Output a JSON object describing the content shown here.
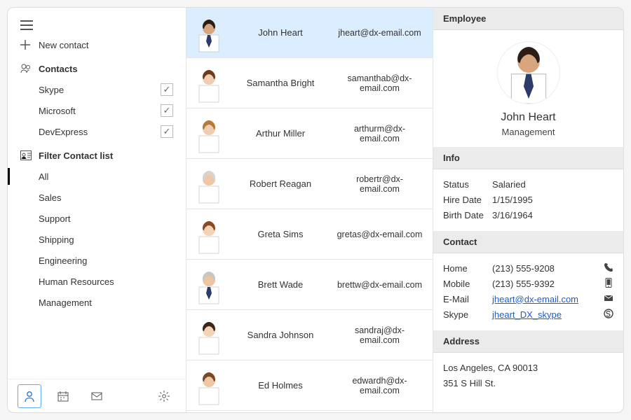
{
  "sidebar": {
    "new_contact": "New contact",
    "contacts_header": "Contacts",
    "groups": [
      {
        "label": "Skype",
        "checked": true
      },
      {
        "label": "Microsoft",
        "checked": true
      },
      {
        "label": "DevExpress",
        "checked": true
      }
    ],
    "filter_header": "Filter Contact list",
    "filters": [
      {
        "label": "All",
        "active": true
      },
      {
        "label": "Sales"
      },
      {
        "label": "Support"
      },
      {
        "label": "Shipping"
      },
      {
        "label": "Engineering"
      },
      {
        "label": "Human Resources"
      },
      {
        "label": "Management"
      }
    ]
  },
  "contacts": [
    {
      "name": "John Heart",
      "email": "jheart@dx-email.com",
      "selected": true,
      "tie": true,
      "hair": "#2b1e14",
      "skin": "#d7a67e"
    },
    {
      "name": "Samantha Bright",
      "email": "samanthab@dx-email.com",
      "selected": false,
      "tie": false,
      "hair": "#6b3b1a",
      "skin": "#f0cdb0"
    },
    {
      "name": "Arthur Miller",
      "email": "arthurm@dx-email.com",
      "selected": false,
      "tie": false,
      "hair": "#b57a36",
      "skin": "#f0cdb0"
    },
    {
      "name": "Robert Reagan",
      "email": "robertr@dx-email.com",
      "selected": false,
      "tie": false,
      "hair": "#d9d3cb",
      "skin": "#eec7a6"
    },
    {
      "name": "Greta Sims",
      "email": "gretas@dx-email.com",
      "selected": false,
      "tie": false,
      "hair": "#8a4a22",
      "skin": "#f3d3b6"
    },
    {
      "name": "Brett Wade",
      "email": "brettw@dx-email.com",
      "selected": false,
      "tie": true,
      "hair": "#c9c6c2",
      "skin": "#eec3a0"
    },
    {
      "name": "Sandra Johnson",
      "email": "sandraj@dx-email.com",
      "selected": false,
      "tie": false,
      "hair": "#3a271a",
      "skin": "#f3d3b6"
    },
    {
      "name": "Ed Holmes",
      "email": "edwardh@dx-email.com",
      "selected": false,
      "tie": false,
      "hair": "#7a4a24",
      "skin": "#eec7a6"
    }
  ],
  "detail": {
    "employee_header": "Employee",
    "name": "John Heart",
    "department": "Management",
    "info_header": "Info",
    "info": {
      "status_label": "Status",
      "status_value": "Salaried",
      "hire_label": "Hire Date",
      "hire_value": "1/15/1995",
      "birth_label": "Birth Date",
      "birth_value": "3/16/1964"
    },
    "contact_header": "Contact",
    "contact": {
      "home_label": "Home",
      "home_value": "(213) 555-9208",
      "mobile_label": "Mobile",
      "mobile_value": "(213) 555-9392",
      "email_label": "E-Mail",
      "email_value": "jheart@dx-email.com",
      "skype_label": "Skype",
      "skype_value": "jheart_DX_skype"
    },
    "address_header": "Address",
    "address": {
      "line1": "Los Angeles, CA 90013",
      "line2": "351 S Hill St."
    }
  }
}
